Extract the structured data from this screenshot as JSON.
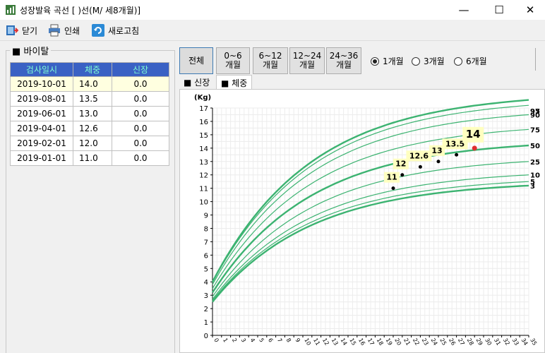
{
  "window": {
    "title": "성장발육 곡선 [  )선(M/ 세8개월)]",
    "minimize": "—",
    "maximize": "☐",
    "close": "✕"
  },
  "toolbar": {
    "close_label": "닫기",
    "print_label": "인쇄",
    "refresh_label": "새로고침"
  },
  "vital": {
    "group_label": "■ 바이탈",
    "headers": [
      "검사일시",
      "체중",
      "신장"
    ],
    "rows": [
      {
        "date": "2019-10-01",
        "weight": "14.0",
        "height": "0.0"
      },
      {
        "date": "2019-08-01",
        "weight": "13.5",
        "height": "0.0"
      },
      {
        "date": "2019-06-01",
        "weight": "13.0",
        "height": "0.0"
      },
      {
        "date": "2019-04-01",
        "weight": "12.6",
        "height": "0.0"
      },
      {
        "date": "2019-02-01",
        "weight": "12.0",
        "height": "0.0"
      },
      {
        "date": "2019-01-01",
        "weight": "11.0",
        "height": "0.0"
      }
    ]
  },
  "range_buttons": [
    {
      "label": "전체"
    },
    {
      "label": "0~6\n개월"
    },
    {
      "label": "6~12\n개월"
    },
    {
      "label": "12~24\n개월"
    },
    {
      "label": "24~36\n개월"
    }
  ],
  "interval_options": [
    {
      "label": "1개월",
      "selected": true
    },
    {
      "label": "3개월",
      "selected": false
    },
    {
      "label": "6개월",
      "selected": false
    }
  ],
  "tabs": [
    {
      "label": "■ 신장"
    },
    {
      "label": "■ 체중"
    }
  ],
  "colors": {
    "header_bg": "#3a61c4",
    "header_text": "#7fffd4",
    "curve": "#3cb371",
    "latest_point": "#e03030",
    "label_bg": "#ffffc0"
  },
  "chart_data": {
    "type": "line",
    "ylabel": "(Kg)",
    "ylim": [
      0,
      17
    ],
    "xlim": [
      0,
      35
    ],
    "yticks": [
      0,
      1,
      2,
      3,
      4,
      5,
      6,
      7,
      8,
      9,
      10,
      11,
      12,
      13,
      14,
      15,
      16,
      17
    ],
    "xticks": [
      0,
      1,
      2,
      3,
      4,
      5,
      6,
      7,
      8,
      9,
      10,
      11,
      12,
      13,
      14,
      15,
      16,
      17,
      18,
      19,
      20,
      21,
      22,
      23,
      24,
      25,
      26,
      27,
      28,
      29,
      30,
      31,
      32,
      33,
      34,
      35
    ],
    "percentile_labels": [
      "97",
      "95",
      "90",
      "75",
      "50",
      "25",
      "10",
      "5",
      "3"
    ],
    "percentiles": [
      {
        "p": "3",
        "start": 2.5,
        "end": 11.2,
        "bold": true
      },
      {
        "p": "5",
        "start": 2.6,
        "end": 11.5,
        "bold": false
      },
      {
        "p": "10",
        "start": 2.7,
        "end": 12.0,
        "bold": false
      },
      {
        "p": "25",
        "start": 2.9,
        "end": 13.0,
        "bold": false
      },
      {
        "p": "50",
        "start": 3.2,
        "end": 14.2,
        "bold": true
      },
      {
        "p": "75",
        "start": 3.5,
        "end": 15.4,
        "bold": false
      },
      {
        "p": "90",
        "start": 3.8,
        "end": 16.5,
        "bold": false
      },
      {
        "p": "95",
        "start": 3.95,
        "end": 17.2,
        "bold": false
      },
      {
        "p": "97",
        "start": 4.0,
        "end": 17.6,
        "bold": true
      }
    ],
    "points": [
      {
        "x": 20,
        "y": 11.0,
        "label": "11"
      },
      {
        "x": 21,
        "y": 12.0,
        "label": "12"
      },
      {
        "x": 23,
        "y": 12.6,
        "label": "12.6"
      },
      {
        "x": 25,
        "y": 13.0,
        "label": "13"
      },
      {
        "x": 27,
        "y": 13.5,
        "label": "13.5"
      },
      {
        "x": 29,
        "y": 14.0,
        "label": "14",
        "latest": true
      }
    ]
  }
}
